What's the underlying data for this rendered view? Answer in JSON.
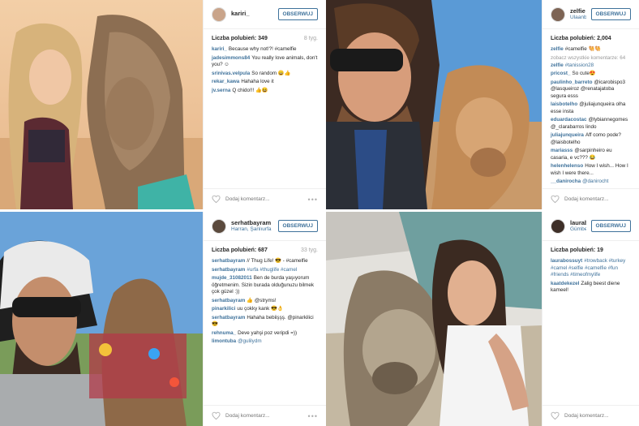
{
  "posts": [
    {
      "user": "kariri_",
      "location": "",
      "follow_label": "OBSERWUJ",
      "likes": "Liczba polubień: 349",
      "time": "8 tyg.",
      "more_comments": "",
      "comments": [
        {
          "user": "kariri_",
          "text": "Because why not!?! #camelfie"
        },
        {
          "user": "jadesimmons84",
          "text": "You really love animals, don't you? ☺"
        },
        {
          "user": "srinivas.velpula",
          "text": "So random 😄👍"
        },
        {
          "user": "rekar_kawa",
          "text": "Hahaha love it"
        },
        {
          "user": "jv.serna",
          "text": "Q chido!!! 👍😆"
        }
      ],
      "add_comment_placeholder": "Dodaj komentarz...",
      "more_icon": "•••"
    },
    {
      "user": "zelfie",
      "location": "Ulaanbaatar, Mo...",
      "follow_label": "OBSERWUJ",
      "likes": "Liczba polubień: 2,004",
      "time": "",
      "more_comments": "zobacz wszystkie komentarze: 64",
      "comments": [
        {
          "user": "zelfie",
          "text": "#camelfie 🐫🐫"
        },
        {
          "user": "zelfie",
          "text": "#tanission28"
        },
        {
          "user": "pricost_",
          "text": "So cute😍"
        },
        {
          "user": "paulinho_barreto",
          "text": "@icarobispo3 @lasqueiroz @renatajatoba segura esss"
        },
        {
          "user": "laisbotelho",
          "text": "@juliajunqueira olha esse insta"
        },
        {
          "user": "eduardacostac",
          "text": "@lybiannegomes @_clarabarros lindo"
        },
        {
          "user": "juliajunqueira",
          "text": "Aff como pode? @laisbotelho"
        },
        {
          "user": "mariasss",
          "text": "@sarpinheiro eu casaria, e vc??? 😂"
        },
        {
          "user": "helenhelenso",
          "text": "How I wish... How I wish I were there..."
        },
        {
          "user": "__danirocha",
          "text": "@danirocht"
        }
      ],
      "add_comment_placeholder": "Dodaj komentarz...",
      "more_icon": "•••"
    },
    {
      "user": "serhatbayram",
      "location": "Harran, Şanlıurfa",
      "follow_label": "OBSERWUJ",
      "likes": "Liczba polubień: 687",
      "time": "33 tyg.",
      "more_comments": "",
      "comments": [
        {
          "user": "serhatbayram",
          "text": "// Thug Life! 😎 - #camelfie"
        },
        {
          "user": "serhatbayram",
          "text": "#urfa #thuglife #camel"
        },
        {
          "user": "mujde_31082011",
          "text": "Ben de burda yaşıyorum öğretmenim. Sizin burada olduğunuzu bilmek çok güzel :))"
        },
        {
          "user": "serhatbayram",
          "text": "👍 @stryms!"
        },
        {
          "user": "pinarkilici",
          "text": "uu çokky kank 😎👌"
        },
        {
          "user": "serhatbayram",
          "text": "Hahaha bebiişşş. @pinarkilici 😎"
        },
        {
          "user": "rehnuma_",
          "text": "Deve yahşi poz veripdi =))"
        },
        {
          "user": "limontuba",
          "text": "@gulilydm"
        }
      ],
      "add_comment_placeholder": "Dodaj komentarz...",
      "more_icon": "•••"
    },
    {
      "user": "laurabossuyt",
      "location": "Gümbet,Bodrum",
      "follow_label": "OBSERWUJ",
      "likes": "Liczba polubień: 19",
      "time": "",
      "more_comments": "",
      "comments": [
        {
          "user": "laurabossuyt",
          "text": "#trowback #turkey #camel #selfie #camelfie #fun #friends #timeofmylife"
        },
        {
          "user": "kaatdekezel",
          "text": "Zalig beest diene kameel!"
        }
      ],
      "add_comment_placeholder": "Dodaj komentarz...",
      "more_icon": "•••"
    }
  ],
  "colors": {
    "link": "#3f729b",
    "border": "#efefef",
    "muted": "#a5a5a5"
  },
  "icons": {
    "heart": "heart-icon",
    "more": "more-options-icon"
  }
}
